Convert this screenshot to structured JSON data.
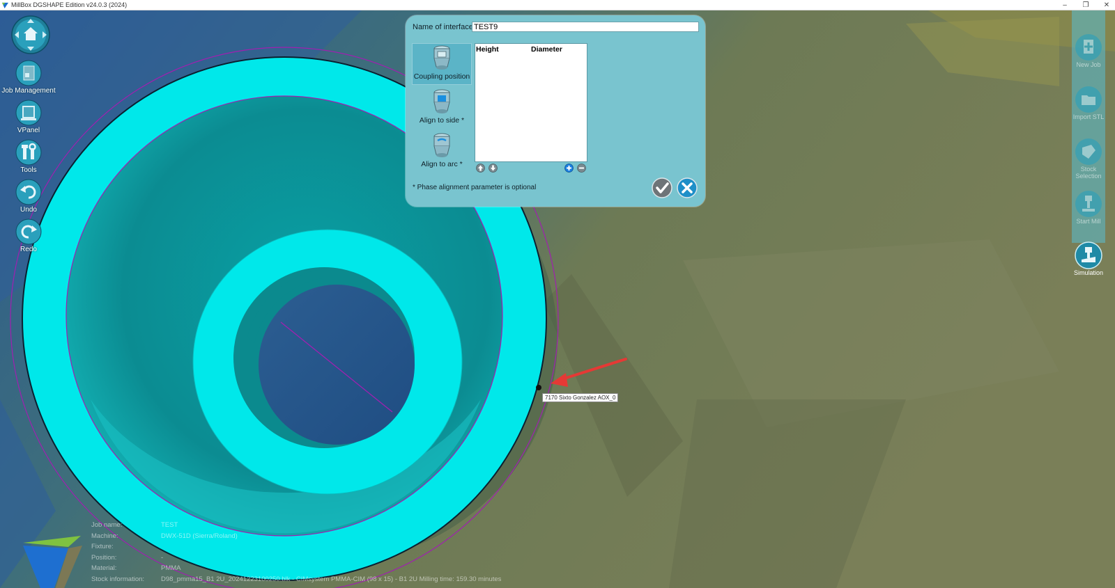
{
  "window": {
    "title": "MillBox DGSHAPE Edition v24.0.3 (2024)",
    "controls": {
      "minimize": "–",
      "restore": "❐",
      "close": "✕"
    }
  },
  "left_toolbar": {
    "items": [
      {
        "id": "nav",
        "label": "",
        "icon": "navigation-home-icon"
      },
      {
        "id": "job",
        "label": "Job Management",
        "icon": "job-management-icon"
      },
      {
        "id": "vpanel",
        "label": "VPanel",
        "icon": "vpanel-icon"
      },
      {
        "id": "tools",
        "label": "Tools",
        "icon": "tools-icon"
      },
      {
        "id": "undo",
        "label": "Undo",
        "icon": "undo-icon"
      },
      {
        "id": "redo",
        "label": "Redo",
        "icon": "redo-icon"
      }
    ]
  },
  "right_toolbar": {
    "items": [
      {
        "label": "New Job",
        "icon": "new-job-icon"
      },
      {
        "label": "Import STL",
        "icon": "import-stl-icon"
      },
      {
        "label": "Stock Selection",
        "icon": "stock-selection-icon"
      },
      {
        "label": "Start Mill",
        "icon": "start-mill-icon"
      },
      {
        "label": "Simulation",
        "icon": "simulation-icon"
      }
    ]
  },
  "dialog": {
    "name_label": "Name of interface:",
    "name_value": "TEST9",
    "modes": [
      {
        "label": "Coupling position",
        "selected": true
      },
      {
        "label": "Align to side *",
        "selected": false
      },
      {
        "label": "Align to arc *",
        "selected": false
      }
    ],
    "table": {
      "col_height": "Height",
      "col_diameter": "Diameter",
      "rows": []
    },
    "note": "* Phase alignment parameter is optional"
  },
  "viewport": {
    "point_label": "7170 Sixto Gonzalez AOX_0"
  },
  "job_info": {
    "job_name_label": "Job name:",
    "job_name": "TEST",
    "machine_label": "Machine:",
    "machine": "DWX-51D (Sierra/Roland)",
    "fixture_label": "Fixture:",
    "fixture": "",
    "position_label": "Position:",
    "position": "-",
    "material_label": "Material:",
    "material": "PMMA",
    "stock_label": "Stock information:",
    "stock": "D98_pmma15_B1 2U_20241223100250.blk - CIMsystem PMMA-CIM (98 x 15) - B1 2U Milling time: 159.30 minutes"
  },
  "colors": {
    "accent": "#00e5e8",
    "dialog_bg": "#79c4cf",
    "selection": "#5bb4c7",
    "arrow": "#e53935",
    "outline": "#9b1fa8"
  }
}
